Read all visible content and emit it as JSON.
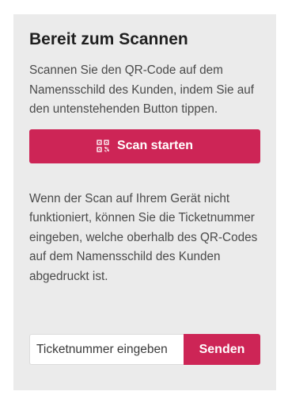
{
  "card": {
    "title": "Bereit zum Scannen",
    "description": "Scannen Sie den QR-Code auf dem Namensschild des Kunden, indem Sie auf den untenstehenden Button tippen.",
    "scan_button": {
      "icon": "qr-code-icon",
      "label": "Scan starten"
    },
    "fallback_text": "Wenn der Scan auf Ihrem Gerät nicht funktioniert, können Sie die Ticketnummer eingeben, welche oberhalb des QR-Codes auf dem Namensschild des Kunden abgedruckt ist.",
    "ticket_input": {
      "placeholder": "Ticketnummer eingeben",
      "value": ""
    },
    "send_button": {
      "label": "Senden"
    }
  },
  "colors": {
    "accent": "#cd2556",
    "card_background": "#ebebeb",
    "page_background": "#ffffff"
  }
}
